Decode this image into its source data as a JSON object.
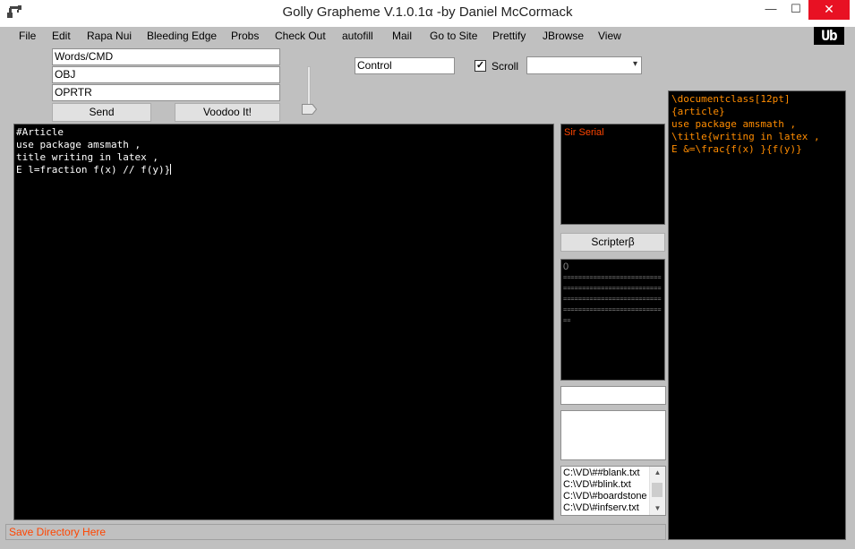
{
  "window": {
    "title": "Golly Grapheme V.1.0.1α -by Daniel McCormack",
    "minimize_glyph": "—",
    "maximize_glyph": "☐",
    "close_glyph": "✕"
  },
  "menu": [
    "File",
    "Edit",
    "Rapa Nui",
    "Bleeding Edge",
    "Probs",
    "Check Out",
    "autofill",
    "Mail",
    "Go to Site",
    "Prettify",
    "JBrowse",
    "View"
  ],
  "logo": {
    "text": "Ub"
  },
  "inputs": {
    "words_cmd": "Words/CMD",
    "obj": "OBJ",
    "oprtr": "OPRTR",
    "control": "Control"
  },
  "buttons": {
    "send": "Send",
    "voodoo": "Voodoo It!",
    "scripter": "Scripterβ"
  },
  "scroll": {
    "label": "Scroll",
    "checked": true,
    "check_glyph": "✓"
  },
  "dropdown": {
    "value": "",
    "arrow_glyph": "▾"
  },
  "editor": {
    "lines": [
      "#Article",
      "use package amsmath ,",
      "title writing in latex ,",
      "E l=fraction f(x) // f(y)}"
    ]
  },
  "serial_panel": {
    "label": "Sir Serial"
  },
  "counter_panel": {
    "value": "0",
    "dashes": "=========================================================================================================="
  },
  "latex_output": {
    "lines": [
      "\\documentclass[12pt]",
      "{article}",
      "use package amsmath ,",
      "\\title{writing in latex ,",
      "E &=\\frac{f(x) }{f(y)}"
    ]
  },
  "file_list": {
    "items": [
      "C:\\VD\\##blank.txt",
      "C:\\VD\\#blink.txt",
      "C:\\VD\\#boardstone",
      "C:\\VD\\#infserv.txt"
    ],
    "scroll_up_glyph": "▲",
    "scroll_down_glyph": "▼"
  },
  "status": {
    "text": "Save Directory Here"
  },
  "colors": {
    "window_bg": "#c0c0c0",
    "panel_bg": "#000000",
    "accent_orange": "#ff8c00",
    "accent_red": "#ff4500",
    "close_red": "#e81123"
  }
}
